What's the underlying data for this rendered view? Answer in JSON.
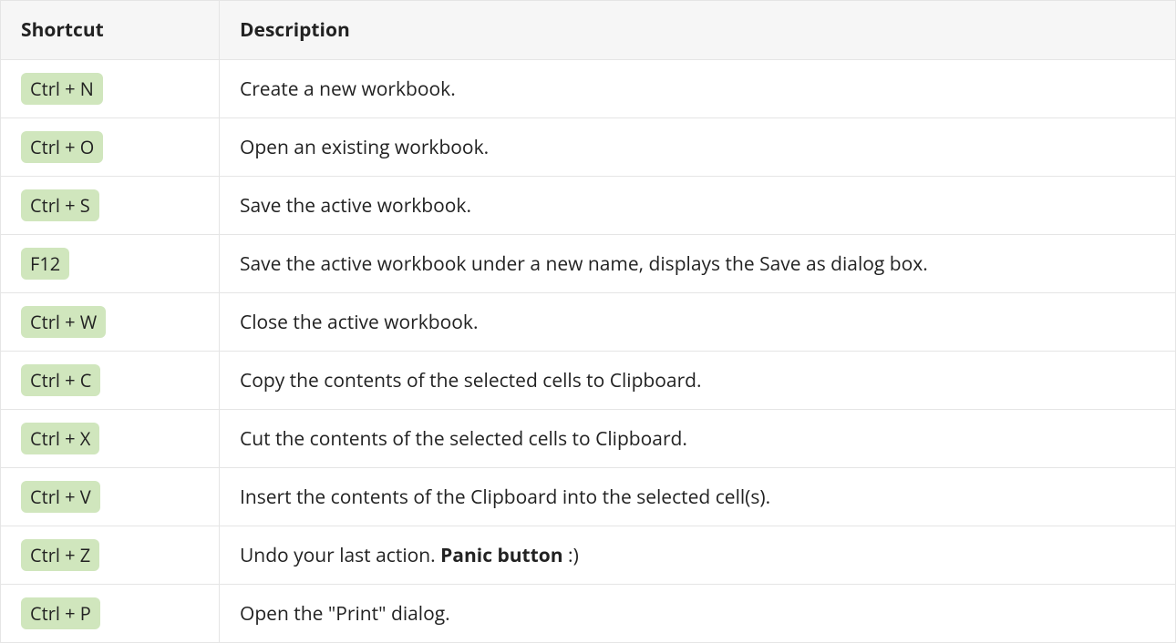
{
  "headers": {
    "shortcut": "Shortcut",
    "description": "Description"
  },
  "rows": [
    {
      "shortcut": "Ctrl + N",
      "description_html": "Create a new workbook."
    },
    {
      "shortcut": "Ctrl + O",
      "description_html": "Open an existing workbook."
    },
    {
      "shortcut": "Ctrl + S",
      "description_html": "Save the active workbook."
    },
    {
      "shortcut": "F12",
      "description_html": "Save the active workbook under a new name, displays the Save as dialog box."
    },
    {
      "shortcut": "Ctrl + W",
      "description_html": "Close the active workbook."
    },
    {
      "shortcut": "Ctrl + C",
      "description_html": "Copy the contents of the selected cells to Clipboard."
    },
    {
      "shortcut": "Ctrl + X",
      "description_html": "Cut the contents of the selected cells to Clipboard."
    },
    {
      "shortcut": "Ctrl + V",
      "description_html": "Insert the contents of the Clipboard into the selected cell(s)."
    },
    {
      "shortcut": "Ctrl + Z",
      "description_html": "Undo your last action. <strong>Panic button</strong> :)"
    },
    {
      "shortcut": "Ctrl + P",
      "description_html": "Open the \"Print\" dialog."
    }
  ]
}
